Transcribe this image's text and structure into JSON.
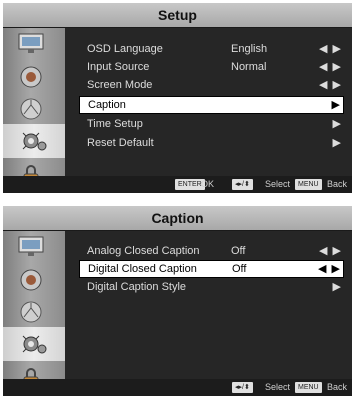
{
  "setup": {
    "title": "Setup",
    "items": [
      {
        "label": "OSD Language",
        "value": "English",
        "arrows": "◀ ▶"
      },
      {
        "label": "Input Source",
        "value": "Normal",
        "arrows": "◀ ▶"
      },
      {
        "label": "Screen Mode",
        "value": "",
        "arrows": "◀ ▶"
      },
      {
        "label": "Caption",
        "value": "",
        "arrows": "▶"
      },
      {
        "label": "Time Setup",
        "value": "",
        "arrows": "▶"
      },
      {
        "label": "Reset Default",
        "value": "",
        "arrows": "▶"
      }
    ],
    "selected_index": 3,
    "footer": {
      "enter_key": "ENTER",
      "enter_label": "OK",
      "nav_key": "◂▸/⬍",
      "select_label": "Select",
      "menu_key": "MENU",
      "back_label": "Back"
    }
  },
  "caption": {
    "title": "Caption",
    "items": [
      {
        "label": "Analog Closed Caption",
        "value": "Off",
        "arrows": "◀ ▶"
      },
      {
        "label": "Digital Closed Caption",
        "value": "Off",
        "arrows": "◀ ▶"
      },
      {
        "label": "Digital Caption Style",
        "value": "",
        "arrows": "▶"
      }
    ],
    "selected_index": 1,
    "footer": {
      "nav_key": "◂▸/⬍",
      "select_label": "Select",
      "menu_key": "MENU",
      "back_label": "Back"
    }
  },
  "sidebar_icons": [
    "picture-icon",
    "audio-icon",
    "channel-icon",
    "setup-icon",
    "lock-icon"
  ],
  "colors": {
    "highlight_bg": "#ffffff",
    "panel_bg": "#262626",
    "title_bar": "#b4b4b4"
  }
}
